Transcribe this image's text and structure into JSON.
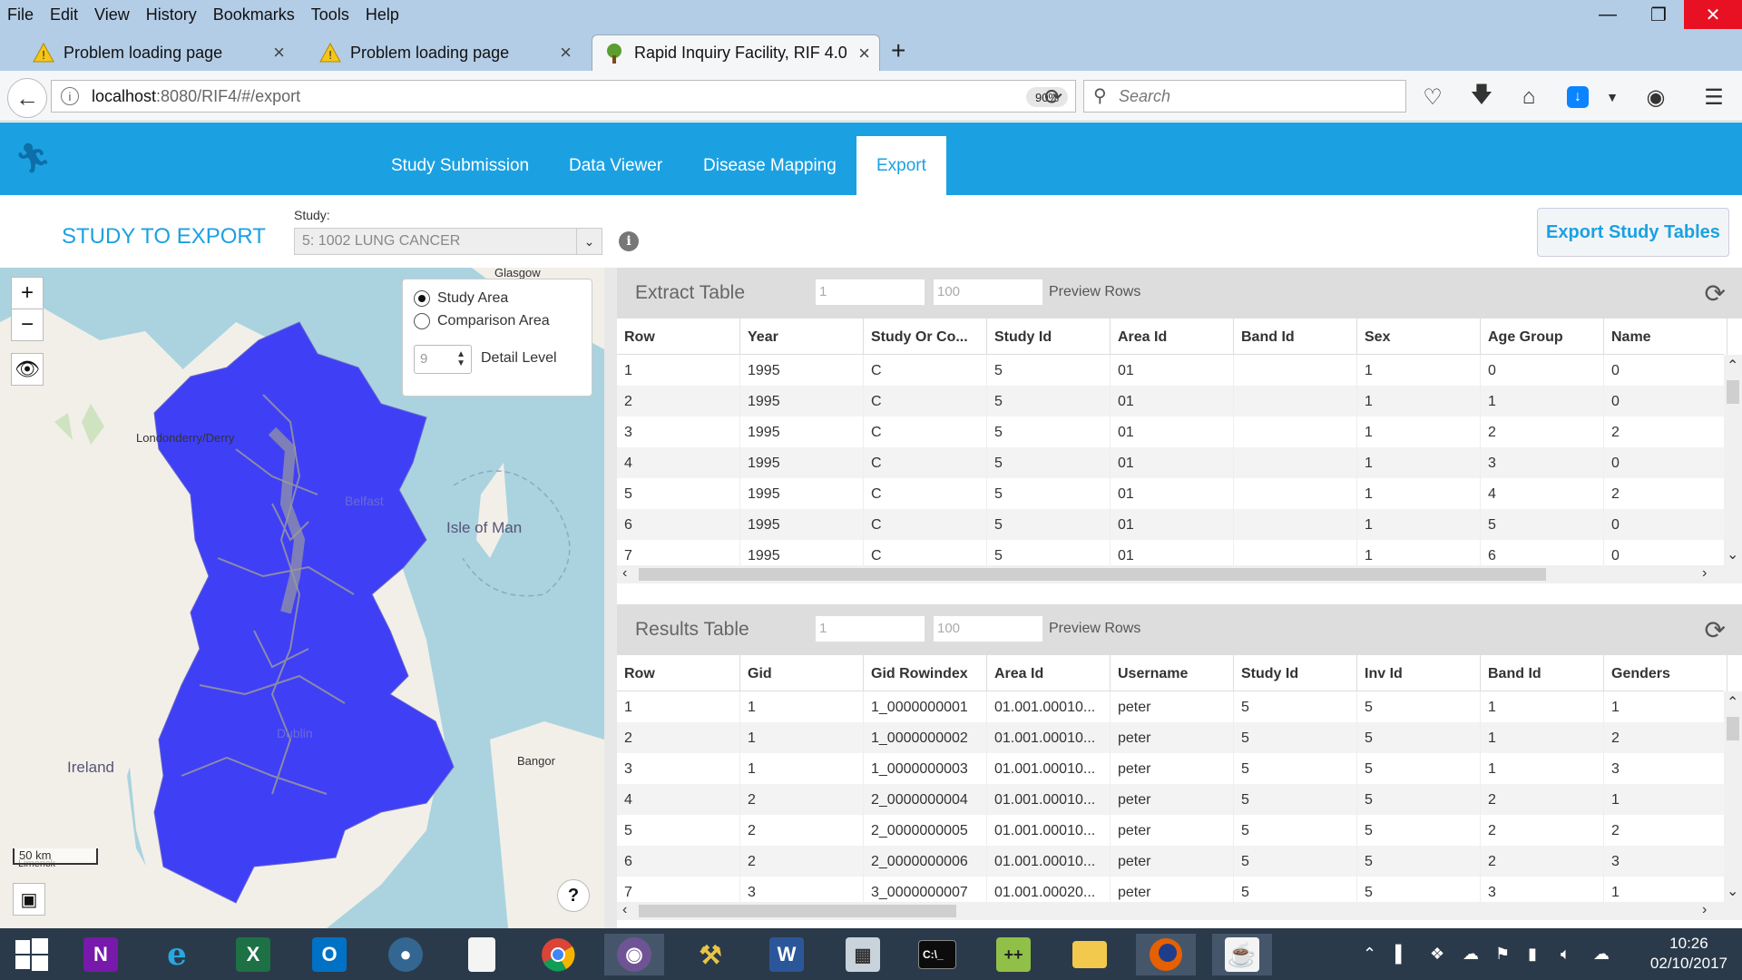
{
  "menu": [
    "File",
    "Edit",
    "View",
    "History",
    "Bookmarks",
    "Tools",
    "Help"
  ],
  "tabs": [
    {
      "title": "Problem loading page"
    },
    {
      "title": "Problem loading page"
    },
    {
      "title": "Rapid Inquiry Facility, RIF 4.0"
    }
  ],
  "url": {
    "host": "localhost",
    "rest": ":8080/RIF4/#/export",
    "zoom": "90%"
  },
  "search_placeholder": "Search",
  "app_nav": [
    "Study Submission",
    "Data Viewer",
    "Disease Mapping",
    "Export"
  ],
  "study_bar": {
    "heading": "STUDY TO EXPORT",
    "study_label": "Study:",
    "study_value": "5: 1002 LUNG CANCER",
    "export_button": "Export Study Tables"
  },
  "map": {
    "zoom_in": "+",
    "zoom_out": "−",
    "study_area": "Study Area",
    "comparison_area": "Comparison Area",
    "selected_area": "study",
    "detail_value": "9",
    "detail_label": "Detail Level",
    "scale": "50 km",
    "help": "?",
    "places": [
      "Glasgow",
      "Londonderry/Derry",
      "Belfast",
      "Isle of Man",
      "Ireland",
      "Dublin",
      "Bangor",
      "Limerick"
    ],
    "study_area_color": "#3f3ff5",
    "water_color": "#aad3df",
    "land_color": "#f2efe9"
  },
  "extract_table": {
    "title": "Extract Table",
    "row_from": "1",
    "row_to": "100",
    "preview_label": "Preview Rows",
    "columns": [
      "Row",
      "Year",
      "Study Or Co...",
      "Study Id",
      "Area Id",
      "Band Id",
      "Sex",
      "Age Group",
      "Name"
    ],
    "rows": [
      [
        "1",
        "1995",
        "C",
        "5",
        "01",
        "",
        "1",
        "0",
        "0"
      ],
      [
        "2",
        "1995",
        "C",
        "5",
        "01",
        "",
        "1",
        "1",
        "0"
      ],
      [
        "3",
        "1995",
        "C",
        "5",
        "01",
        "",
        "1",
        "2",
        "2"
      ],
      [
        "4",
        "1995",
        "C",
        "5",
        "01",
        "",
        "1",
        "3",
        "0"
      ],
      [
        "5",
        "1995",
        "C",
        "5",
        "01",
        "",
        "1",
        "4",
        "2"
      ],
      [
        "6",
        "1995",
        "C",
        "5",
        "01",
        "",
        "1",
        "5",
        "0"
      ],
      [
        "7",
        "1995",
        "C",
        "5",
        "01",
        "",
        "1",
        "6",
        "0"
      ]
    ]
  },
  "results_table": {
    "title": "Results Table",
    "row_from": "1",
    "row_to": "100",
    "preview_label": "Preview Rows",
    "columns": [
      "Row",
      "Gid",
      "Gid Rowindex",
      "Area Id",
      "Username",
      "Study Id",
      "Inv Id",
      "Band Id",
      "Genders"
    ],
    "rows": [
      [
        "1",
        "1",
        "1_0000000001",
        "01.001.00010...",
        "peter",
        "5",
        "5",
        "1",
        "1"
      ],
      [
        "2",
        "1",
        "1_0000000002",
        "01.001.00010...",
        "peter",
        "5",
        "5",
        "1",
        "2"
      ],
      [
        "3",
        "1",
        "1_0000000003",
        "01.001.00010...",
        "peter",
        "5",
        "5",
        "1",
        "3"
      ],
      [
        "4",
        "2",
        "2_0000000004",
        "01.001.00010...",
        "peter",
        "5",
        "5",
        "2",
        "1"
      ],
      [
        "5",
        "2",
        "2_0000000005",
        "01.001.00010...",
        "peter",
        "5",
        "5",
        "2",
        "2"
      ],
      [
        "6",
        "2",
        "2_0000000006",
        "01.001.00010...",
        "peter",
        "5",
        "5",
        "2",
        "3"
      ],
      [
        "7",
        "3",
        "3_0000000007",
        "01.001.00020...",
        "peter",
        "5",
        "5",
        "3",
        "1"
      ]
    ]
  },
  "taskbar_apps": [
    "start",
    "onenote",
    "ie",
    "excel",
    "outlook",
    "pgadmin",
    "notepad",
    "chrome",
    "github",
    "tools",
    "word",
    "calculator",
    "cmd",
    "notepadpp",
    "explorer",
    "firefox",
    "java"
  ],
  "clock": {
    "time": "10:26",
    "date": "02/10/2017"
  }
}
